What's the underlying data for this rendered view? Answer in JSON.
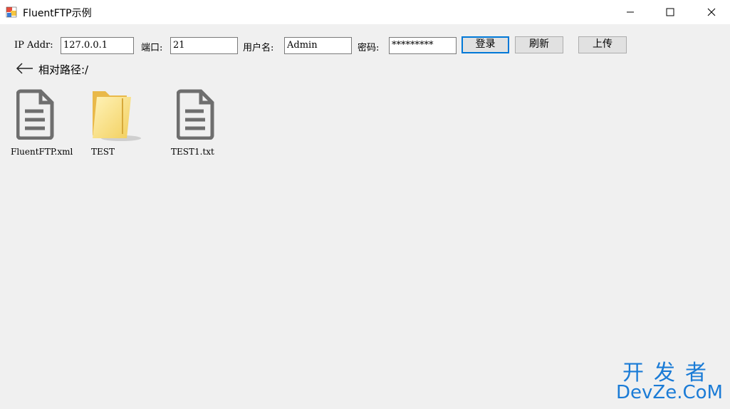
{
  "window": {
    "title": "FluentFTP示例",
    "icon": "app-window-icon"
  },
  "form": {
    "ip_label": "IP Addr:",
    "ip_value": "127.0.0.1",
    "port_label": "端口:",
    "port_value": "21",
    "user_label": "用户名:",
    "user_value": "Admin",
    "password_label": "密码:",
    "password_value": "*********",
    "login_button": "登录",
    "refresh_button": "刷新",
    "upload_button": "上传"
  },
  "path": {
    "back_icon": "arrow-left-icon",
    "label": "相对路径:/"
  },
  "files": [
    {
      "name": "FluentFTP.xml",
      "icon": "document-icon"
    },
    {
      "name": "TEST",
      "icon": "folder-icon"
    },
    {
      "name": "TEST1.txt",
      "icon": "document-icon"
    }
  ],
  "watermark": {
    "line1": "开发者",
    "line2": "DevZe.CoM"
  },
  "colors": {
    "accent": "#0078d7",
    "watermark": "#1a7bd6",
    "background": "#f0f0f0"
  }
}
